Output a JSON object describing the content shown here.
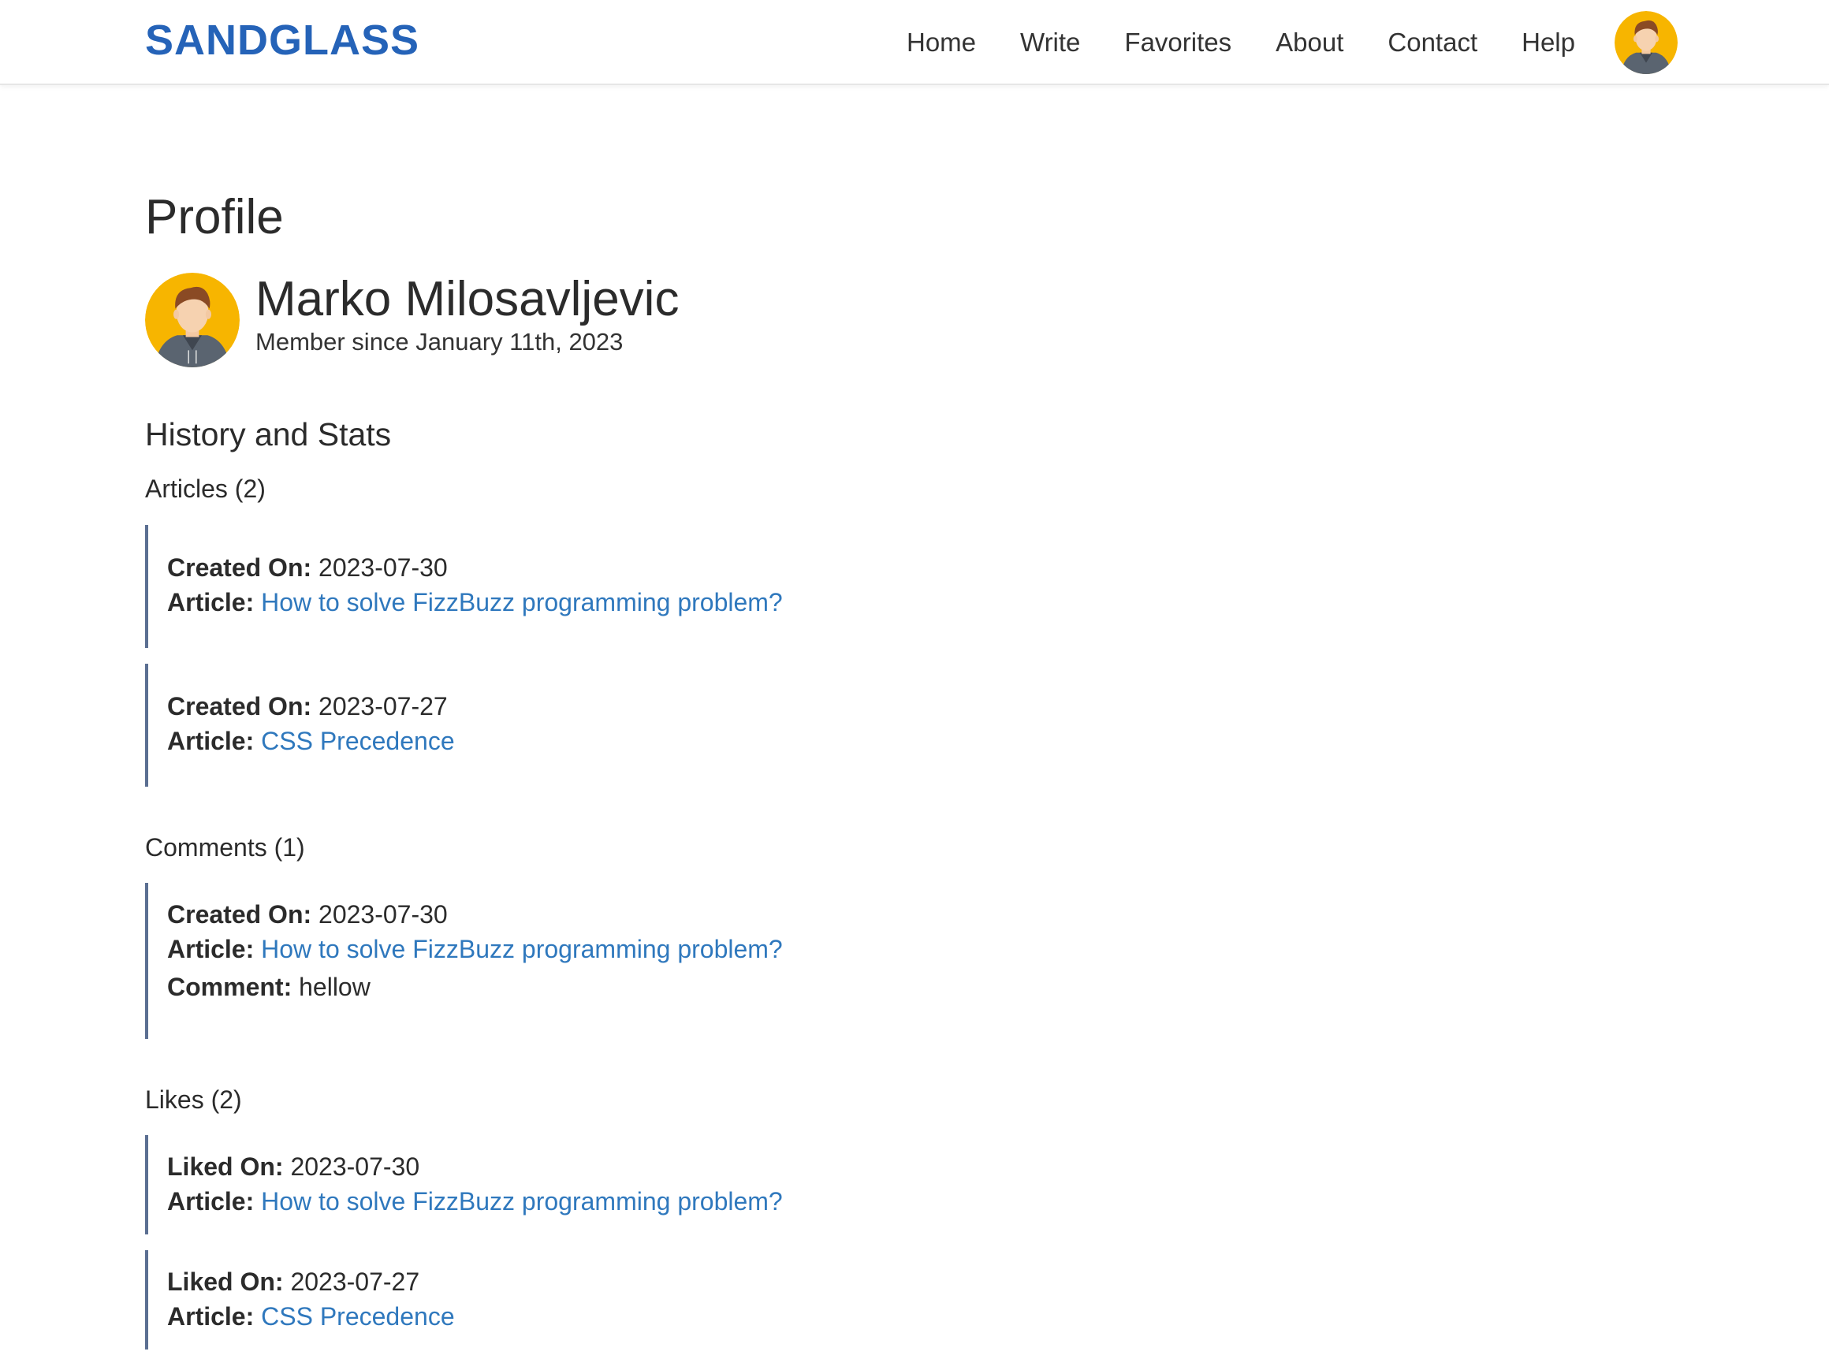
{
  "brand": "SANDGLASS",
  "nav": {
    "home": "Home",
    "write": "Write",
    "favorites": "Favorites",
    "about": "About",
    "contact": "Contact",
    "help": "Help",
    "avatar_icon": "user-avatar-icon"
  },
  "profile": {
    "title": "Profile",
    "name": "Marko Milosavljevic",
    "member_since": "Member since January 11th, 2023"
  },
  "history": {
    "title": "History and Stats",
    "articles": {
      "title": "Articles (2)",
      "items": [
        {
          "created_label": "Created On:",
          "created": "2023-07-30",
          "article_label": "Article:",
          "article": "How to solve FizzBuzz programming problem?"
        },
        {
          "created_label": "Created On:",
          "created": "2023-07-27",
          "article_label": "Article:",
          "article": "CSS Precedence"
        }
      ]
    },
    "comments": {
      "title": "Comments (1)",
      "items": [
        {
          "created_label": "Created On:",
          "created": "2023-07-30",
          "article_label": "Article:",
          "article": "How to solve FizzBuzz programming problem?",
          "comment_label": "Comment:",
          "comment": "hellow"
        }
      ]
    },
    "likes": {
      "title": "Likes (2)",
      "items": [
        {
          "liked_label": "Liked On:",
          "liked": "2023-07-30",
          "article_label": "Article:",
          "article": "How to solve FizzBuzz programming problem?"
        },
        {
          "liked_label": "Liked On:",
          "liked": "2023-07-27",
          "article_label": "Article:",
          "article": "CSS Precedence"
        }
      ]
    }
  },
  "colors": {
    "brand": "#2563b8",
    "link": "#2f78bd",
    "card_border": "#5b6f92",
    "avatar_bg": "#f7b500"
  }
}
